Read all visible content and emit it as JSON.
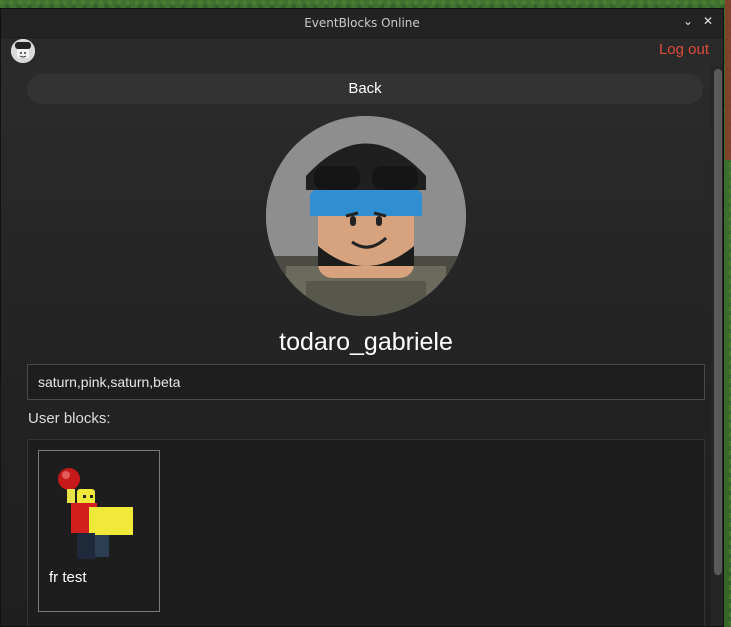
{
  "window": {
    "title": "EventBlocks Online",
    "minimize_glyph": "⌄",
    "close_glyph": "✕"
  },
  "header": {
    "logout_label": "Log out"
  },
  "profile": {
    "back_label": "Back",
    "username": "todaro_gabriele",
    "tags_value": "saturn,pink,saturn,beta"
  },
  "blocks": {
    "label": "User blocks:",
    "items": [
      {
        "name": "fr test"
      }
    ]
  },
  "colors": {
    "logout": "#e04a3a",
    "window_bg": "#262626",
    "helmet_blue": "#2f8fd1"
  },
  "icons": {
    "small_avatar": "user-avatar-icon",
    "minimize": "chevron-down-icon",
    "close": "close-icon"
  }
}
